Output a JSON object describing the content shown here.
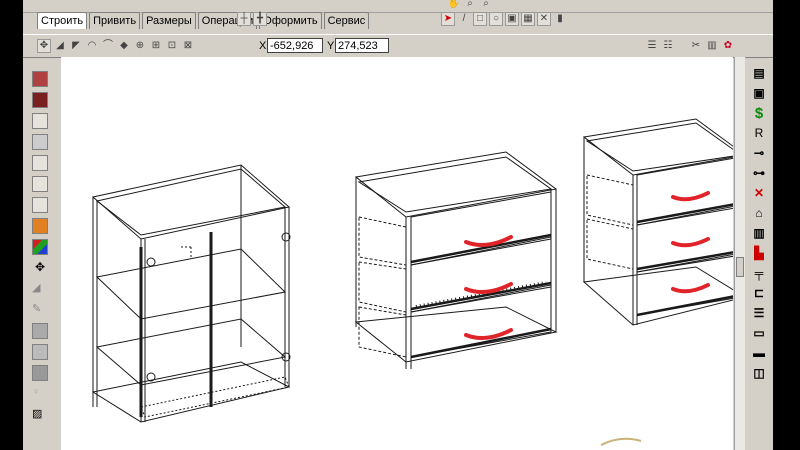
{
  "menu": {
    "tabs": [
      {
        "label": "Строить"
      },
      {
        "label": "Привить"
      },
      {
        "label": "Размеры"
      },
      {
        "label": "Операции"
      },
      {
        "label": "Оформить"
      },
      {
        "label": "Сервис"
      }
    ]
  },
  "coordinates": {
    "x_label": "X",
    "x_value": "-652,926",
    "y_label": "Y",
    "y_value": "274,523"
  },
  "colors": {
    "window_bg": "#d4d0c8",
    "canvas_bg": "#ffffff",
    "handle_red": "#e0242a",
    "wireframe": "#1a1a1a"
  },
  "icons": {
    "left_toolbar": [
      "box-icon",
      "box-dark-icon",
      "box-outline-icon",
      "panel-icon",
      "stack-icon",
      "frame-icon",
      "shelf-icon",
      "wireframe-box-icon",
      "orange-cube-icon",
      "color-cube-icon",
      "move-icon",
      "select-icon",
      "edit-icon",
      "extrude-icon",
      "mirror-icon",
      "material-icon",
      "gray-cube-icon",
      "lamp-icon",
      "camera-icon"
    ],
    "right_toolbar": [
      "plan-icon",
      "layers-icon",
      "dollar-icon",
      "letter-r-icon",
      "screw-icon",
      "dowel-icon",
      "no-fastener-icon",
      "cabinet-icon",
      "hinge-icon",
      "red-green-icon",
      "rail-icon",
      "handle-icon",
      "shelf-tool-icon",
      "drawer-icon",
      "bottom-icon",
      "box-3d-icon"
    ]
  }
}
